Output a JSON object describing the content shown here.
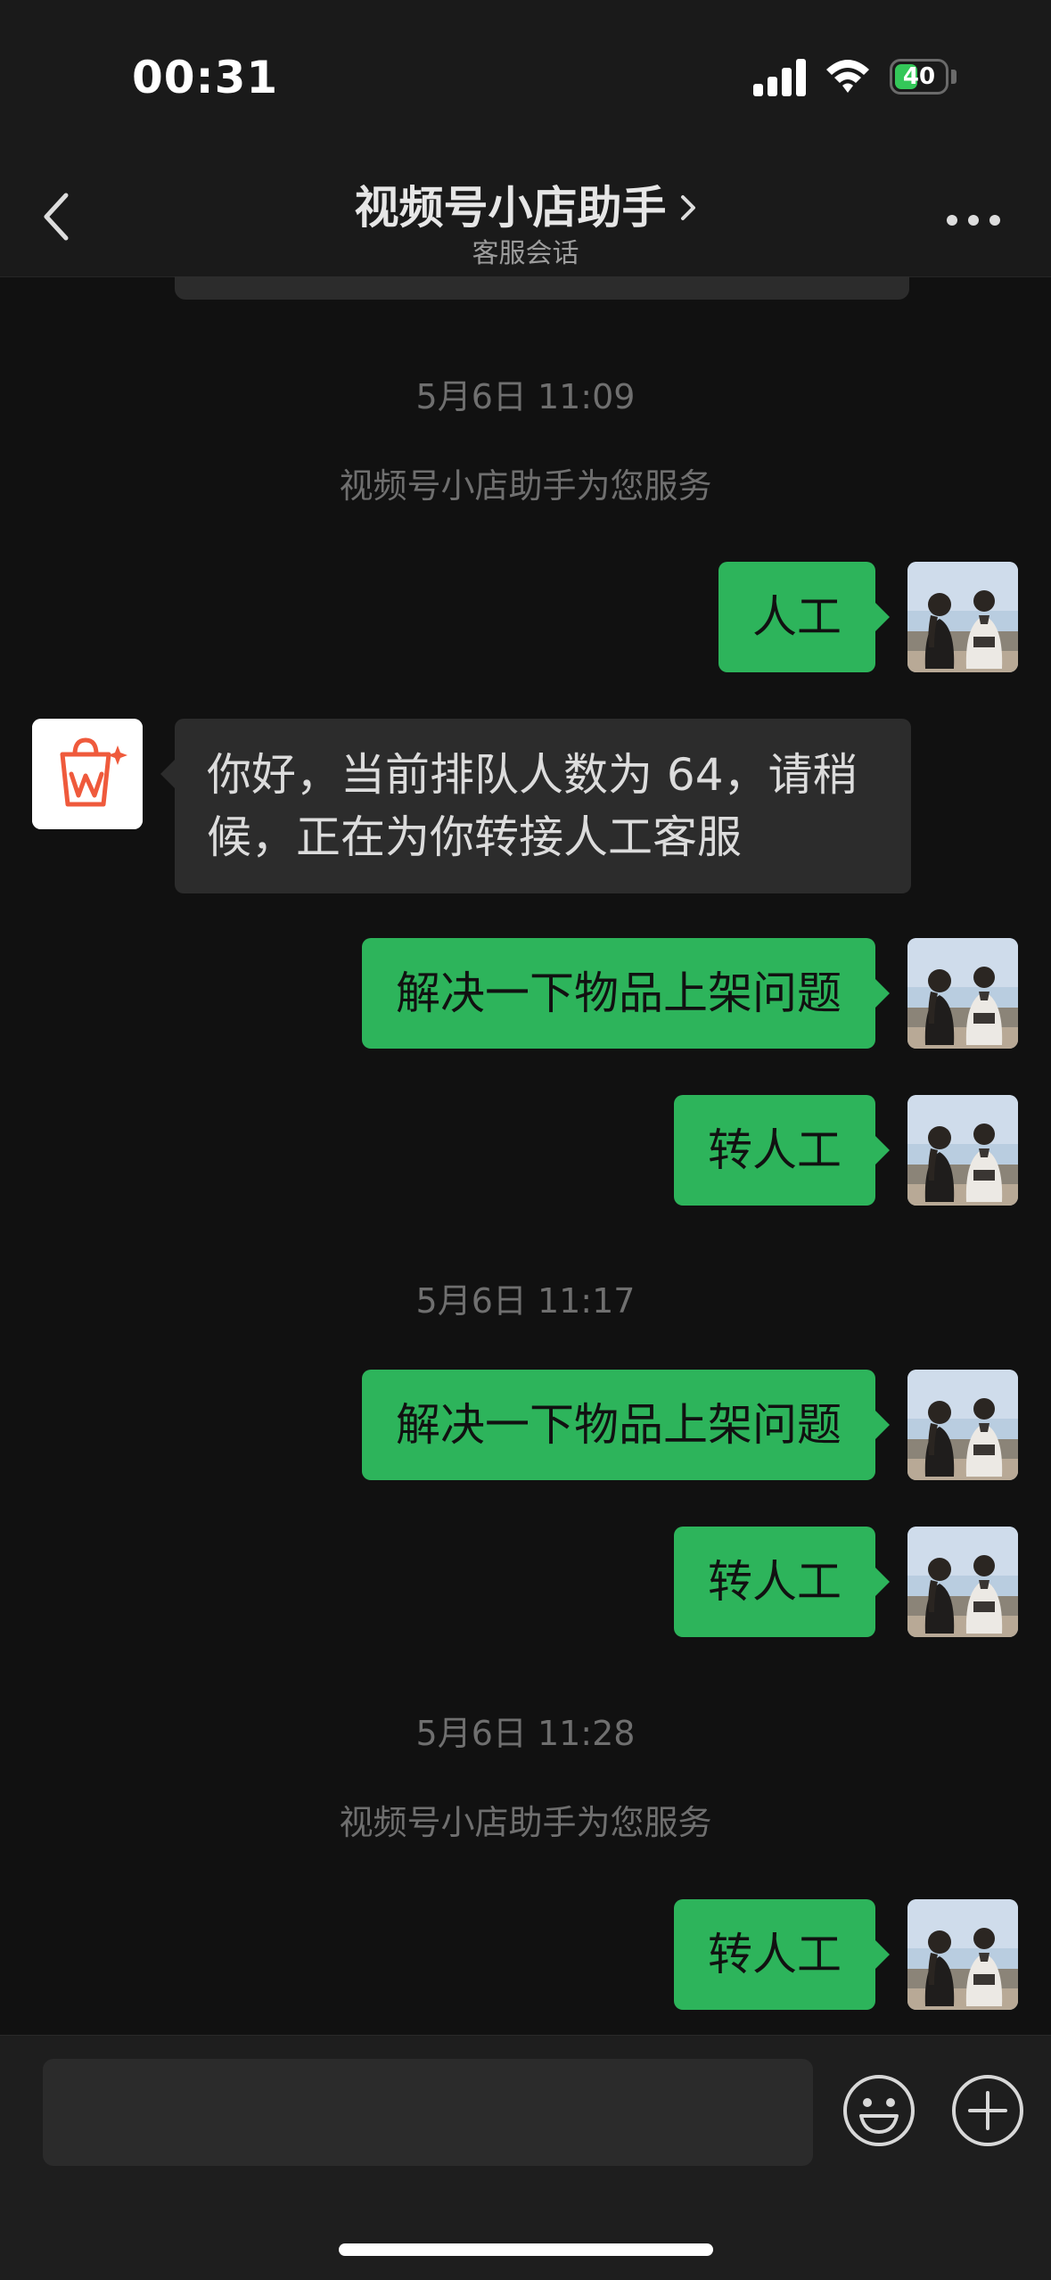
{
  "status_bar": {
    "time": "00:31",
    "battery_level": "40",
    "battery_color": "#34c759"
  },
  "nav": {
    "title": "视频号小店助手",
    "subtitle": "客服会话",
    "back_icon": "chevron-left-icon",
    "title_chevron_icon": "chevron-right-icon",
    "more_icon": "ellipsis-icon"
  },
  "messages": {
    "timestamp_1": "5月6日 11:09",
    "system_1": "视频号小店助手为您服务",
    "m1": "人工",
    "bot_reply": "你好，当前排队人数为 64，请稍候，正在为你转接人工客服",
    "m2": "解决一下物品上架问题",
    "m3": "转人工",
    "timestamp_2": "5月6日 11:17",
    "m4": "解决一下物品上架问题",
    "m5": "转人工",
    "timestamp_3": "5月6日 11:28",
    "system_2": "视频号小店助手为您服务",
    "m6": "转人工"
  },
  "input_bar": {
    "emoji_icon": "emoji-icon",
    "plus_icon": "plus-circle-icon"
  },
  "colors": {
    "sent_bubble": "#2db45b",
    "received_bubble": "#2c2c2c",
    "background": "#111111",
    "bot_logo": "#ef5a3c"
  }
}
